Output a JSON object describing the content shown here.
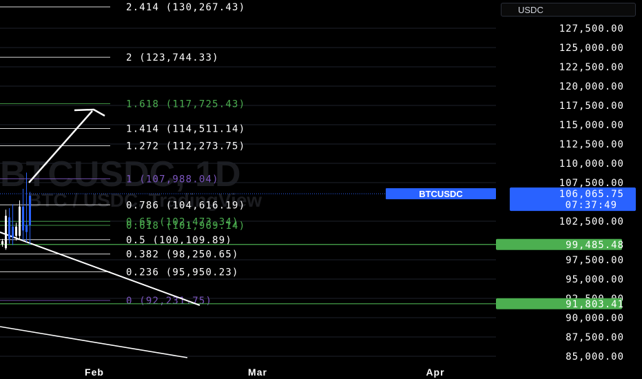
{
  "currency": "USDC",
  "chart_data": {
    "type": "candlestick",
    "symbol_label": "BTCUSDC",
    "watermark": {
      "title": "BTCUSDC, 1D",
      "subtitle": "BTC / USDC, TradingView"
    },
    "y_axis": {
      "min": 85000,
      "max": 127500,
      "ticks": [
        "127,500.00",
        "125,000.00",
        "122,500.00",
        "120,000.00",
        "117,500.00",
        "115,000.00",
        "112,500.00",
        "110,000.00",
        "107,500.00",
        "102,500.00",
        "97,500.00",
        "95,000.00",
        "92,500.00",
        "90,000.00",
        "87,500.00",
        "85,000.00"
      ],
      "tick_values": [
        127500,
        125000,
        122500,
        120000,
        117500,
        115000,
        112500,
        110000,
        107500,
        102500,
        97500,
        95000,
        92500,
        90000,
        87500,
        85000
      ]
    },
    "x_axis": {
      "labels": [
        "Feb",
        "Mar",
        "Apr"
      ]
    },
    "fib_levels": [
      {
        "ratio": "2.414",
        "label": "2.414 (130,267.43)",
        "price": 130267.43,
        "color": "#ffffff"
      },
      {
        "ratio": "2",
        "label": "2 (123,744.33)",
        "price": 123744.33,
        "color": "#ffffff"
      },
      {
        "ratio": "1.618",
        "label": "1.618 (117,725.43)",
        "price": 117725.43,
        "color": "#4caf50"
      },
      {
        "ratio": "1.414",
        "label": "1.414 (114,511.14)",
        "price": 114511.14,
        "color": "#ffffff"
      },
      {
        "ratio": "1.272",
        "label": "1.272 (112,273.75)",
        "price": 112273.75,
        "color": "#ffffff"
      },
      {
        "ratio": "1",
        "label": "1 (107,988.04)",
        "price": 107988.04,
        "color": "#7e57c2"
      },
      {
        "ratio": "0.786",
        "label": "0.786 (104,616.19)",
        "price": 104616.19,
        "color": "#ffffff"
      },
      {
        "ratio": "0.65",
        "label": "0.65 (102,473.34)",
        "price": 102473.34,
        "color": "#4caf50"
      },
      {
        "ratio": "0.618",
        "label": "0.618 (101,969.14)",
        "price": 101969.14,
        "color": "#4caf50"
      },
      {
        "ratio": "0.5",
        "label": "0.5 (100,109.89)",
        "price": 100109.89,
        "color": "#ffffff"
      },
      {
        "ratio": "0.382",
        "label": "0.382 (98,250.65)",
        "price": 98250.65,
        "color": "#ffffff"
      },
      {
        "ratio": "0.236",
        "label": "0.236 (95,950.23)",
        "price": 95950.23,
        "color": "#ffffff"
      },
      {
        "ratio": "0",
        "label": "0 (92,231.75)",
        "price": 92231.75,
        "color": "#7e57c2"
      }
    ],
    "horizontal_lines": [
      {
        "price": 99485.48,
        "label": "99,485.48",
        "color": "#4caf50"
      },
      {
        "price": 91803.41,
        "label": "91,803.41",
        "color": "#4caf50"
      }
    ],
    "last_price": {
      "price": 106065.75,
      "label": "106,065.75",
      "countdown": "07:37:49",
      "color": "#2962ff"
    },
    "candles": [
      {
        "o": 99900,
        "h": 100200,
        "l": 99200,
        "c": 99500,
        "color": "#ffffff"
      },
      {
        "o": 99000,
        "h": 104000,
        "l": 98800,
        "c": 103200,
        "color": "#ffffff"
      },
      {
        "o": 103000,
        "h": 104200,
        "l": 99600,
        "c": 100200,
        "color": "#2962ff"
      },
      {
        "o": 100400,
        "h": 104700,
        "l": 99400,
        "c": 101800,
        "color": "#2962ff"
      },
      {
        "o": 101800,
        "h": 102300,
        "l": 100000,
        "c": 100600,
        "color": "#ffffff"
      },
      {
        "o": 100600,
        "h": 105200,
        "l": 100200,
        "c": 104400,
        "color": "#ffffff"
      },
      {
        "o": 104400,
        "h": 106700,
        "l": 100000,
        "c": 101300,
        "color": "#2962ff"
      },
      {
        "o": 101100,
        "h": 108800,
        "l": 99800,
        "c": 102000,
        "color": "#2962ff"
      },
      {
        "o": 102000,
        "h": 106300,
        "l": 99500,
        "c": 105800,
        "color": "#2962ff"
      }
    ],
    "colors": {
      "background": "#000000",
      "grid": "#1e222d",
      "axis_text": "#ffffff",
      "trendline": "#ffffff",
      "label_box_dark": "#0c3299"
    }
  }
}
